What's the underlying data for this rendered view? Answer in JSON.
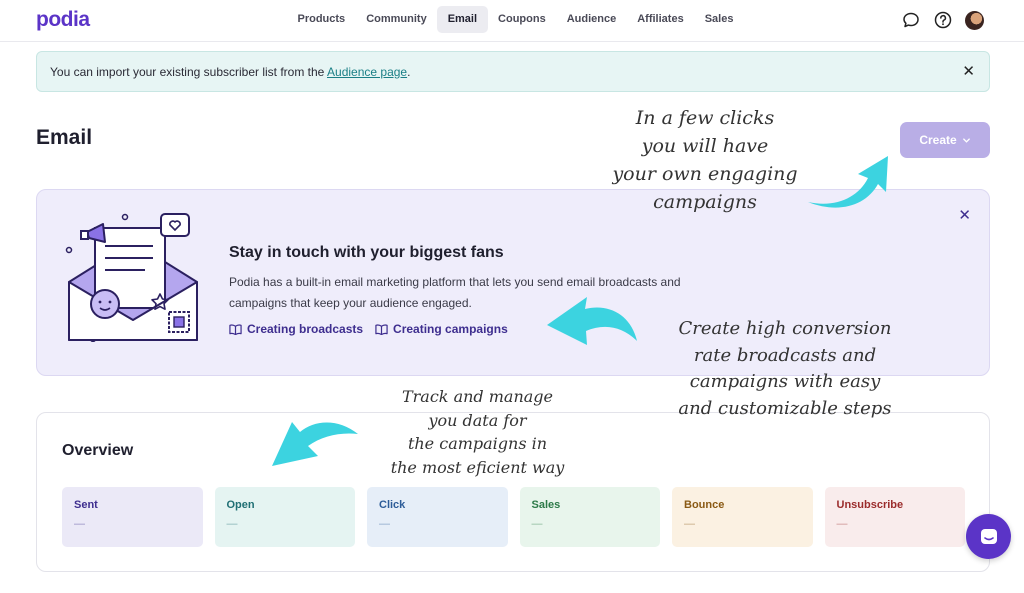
{
  "brand": {
    "logo": "podia",
    "color": "#5b34c7"
  },
  "nav": {
    "items": [
      {
        "label": "Products"
      },
      {
        "label": "Community"
      },
      {
        "label": "Email",
        "active": true
      },
      {
        "label": "Coupons"
      },
      {
        "label": "Audience"
      },
      {
        "label": "Affiliates"
      },
      {
        "label": "Sales"
      }
    ],
    "icons": [
      "chat-bubble-icon",
      "help-icon",
      "user-avatar"
    ]
  },
  "banner": {
    "text": "You can import your existing subscriber list from the ",
    "link_text": "Audience page",
    "suffix": ".",
    "close": "✕"
  },
  "page": {
    "title": "Email",
    "create_label": "Create"
  },
  "promo": {
    "title": "Stay in touch with your biggest fans",
    "description": "Podia has a built-in email marketing platform that lets you send email broadcasts and campaigns that keep your audience engaged.",
    "links": [
      {
        "label": "Creating broadcasts"
      },
      {
        "label": "Creating campaigns"
      }
    ],
    "close": "✕"
  },
  "overview": {
    "title": "Overview",
    "stats": [
      {
        "label": "Sent",
        "value": "—",
        "bg": "#ebe9f7",
        "fg": "#3e2e8f"
      },
      {
        "label": "Open",
        "value": "—",
        "bg": "#e5f4f2",
        "fg": "#1f6f74"
      },
      {
        "label": "Click",
        "value": "—",
        "bg": "#e6eef8",
        "fg": "#2d5c98"
      },
      {
        "label": "Sales",
        "value": "—",
        "bg": "#e8f5ec",
        "fg": "#2c7a48"
      },
      {
        "label": "Bounce",
        "value": "—",
        "bg": "#fbf1e2",
        "fg": "#8a5a14"
      },
      {
        "label": "Unsubscribe",
        "value": "—",
        "bg": "#f9ecec",
        "fg": "#9b2c2c"
      }
    ]
  },
  "annotations": {
    "note1": [
      "In a few clicks",
      "you will have",
      "your own engaging",
      "campaigns"
    ],
    "note2": [
      "Create high conversion",
      "rate broadcasts and",
      "campaigns with easy",
      "and customizable steps"
    ],
    "note3": [
      "Track and manage",
      "you data for",
      "the campaigns in",
      "the most eficient way"
    ],
    "arrow_color": "#3cd3e0"
  }
}
